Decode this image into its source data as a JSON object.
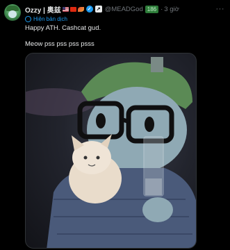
{
  "post": {
    "display_name": "Ozzy | 奥兹",
    "verified_mark": "✓",
    "affiliate_mark": "↗",
    "handle": "@MEADGod",
    "badge": "186",
    "separator": "·",
    "time": "3 giờ",
    "more": "···",
    "translate_label": "Hiện bản dịch",
    "text_line1": "Happy ATH. Cashcat gud.",
    "text_line2": "Meow pss pss pss psss"
  },
  "media": {
    "description_icon": "image-icon"
  },
  "colors": {
    "accent": "#1d9bf0",
    "badge_bg": "#2e7d3a",
    "muted": "#71767b"
  }
}
